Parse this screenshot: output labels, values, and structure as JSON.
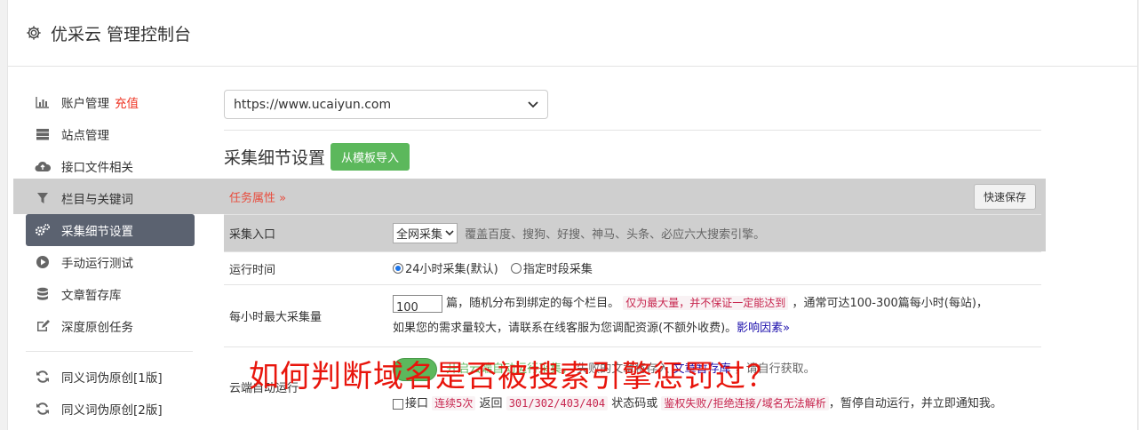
{
  "header": {
    "title": "优采云 管理控制台",
    "icon": "gear-icon"
  },
  "sidebar": {
    "items": [
      {
        "label": "账户管理",
        "extra": "充值",
        "icon": "bar-chart-icon"
      },
      {
        "label": "站点管理",
        "icon": "server-icon"
      },
      {
        "label": "接口文件相关",
        "icon": "cloud-upload-icon"
      },
      {
        "label": "栏目与关键词",
        "icon": "filter-icon"
      },
      {
        "label": "采集细节设置",
        "icon": "gears-icon",
        "active": true
      },
      {
        "label": "手动运行测试",
        "icon": "play-circle-icon"
      },
      {
        "label": "文章暂存库",
        "icon": "database-icon"
      },
      {
        "label": "深度原创任务",
        "icon": "edit-icon"
      },
      {
        "label": "同义词伪原创[1版]",
        "icon": "refresh-icon"
      },
      {
        "label": "同义词伪原创[2版]",
        "icon": "refresh-icon"
      }
    ]
  },
  "main": {
    "site_select": "https://www.ucaiyun.com",
    "section_title": "采集细节设置",
    "import_button": "从模板导入",
    "task_label": "任务属性 »",
    "save_button": "快速保存",
    "rows": {
      "entry": {
        "key": "采集入口",
        "select": "全网采集",
        "desc": "覆盖百度、搜狗、好搜、神马、头条、必应六大搜索引擎。"
      },
      "runtime": {
        "key": "运行时间",
        "opt1": "24小时采集(默认)",
        "opt2": "指定时段采集"
      },
      "max": {
        "key": "每小时最大采集量",
        "value": "100",
        "t1": "篇，随机分布到绑定的每个栏目。",
        "pink1": "仅为最大量，并不保证一定能达到",
        "t2": "，通常可达100-300篇每小时(每站)，",
        "t3": "如果您的需求量较大，请联系在线客服为您调配资源(不额外收费)。",
        "link": "影响因素»"
      },
      "cloud": {
        "key": "云端自动运行",
        "l1a": "开启云端自动运行采集，",
        "l1b": "失败的文章将存入",
        "l1link": "文章暂存库",
        "l1c": "，请自行获取。",
        "l2a": "接口",
        "pink_a": "连续5次",
        "l2b": "返回",
        "pink_b": "301/302/403/404",
        "l2c": "状态码或",
        "pink_c": "鉴权失败/拒绝连接/域名无法解析",
        "l2d": "，暂停自动运行，并立即通知我。"
      }
    }
  },
  "watermark": "如何判断域名是否被搜索引擎惩罚过？",
  "colors": {
    "accent_green": "#5cb85c",
    "active_nav": "#5b6270",
    "alert_red": "#e84c3d",
    "watermark_red": "#e8150c"
  }
}
